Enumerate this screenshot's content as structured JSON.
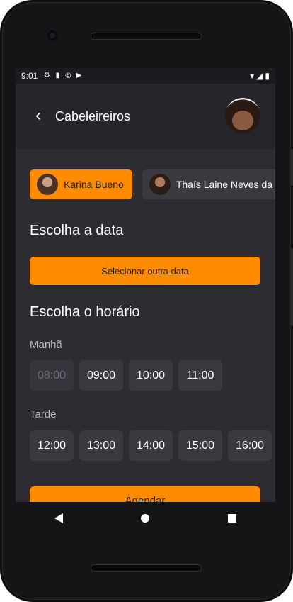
{
  "status_bar": {
    "time": "9:01",
    "icons": [
      "gear-icon",
      "sd-card-icon",
      "at-icon",
      "play-store-icon"
    ],
    "right_icons": [
      "wifi-icon",
      "signal-icon",
      "battery-icon"
    ]
  },
  "app_bar": {
    "title": "Cabeleireiros",
    "back_icon": "chevron-left-icon"
  },
  "professionals": [
    {
      "name": "Karina Bueno",
      "selected": true
    },
    {
      "name": "Thaís Laine Neves da S",
      "selected": false
    }
  ],
  "date_section": {
    "title": "Escolha a data",
    "button_label": "Selecionar outra data"
  },
  "time_section": {
    "title": "Escolha o horário",
    "morning_label": "Manhã",
    "morning_slots": [
      {
        "time": "08:00",
        "available": false
      },
      {
        "time": "09:00",
        "available": true
      },
      {
        "time": "10:00",
        "available": true
      },
      {
        "time": "11:00",
        "available": true
      }
    ],
    "afternoon_label": "Tarde",
    "afternoon_slots": [
      {
        "time": "12:00",
        "available": true
      },
      {
        "time": "13:00",
        "available": true
      },
      {
        "time": "14:00",
        "available": true
      },
      {
        "time": "15:00",
        "available": true
      },
      {
        "time": "16:00",
        "available": true
      }
    ]
  },
  "schedule_button": "Agendar",
  "colors": {
    "accent": "#ff8c00",
    "background": "#2d2c33",
    "appbar": "#26252b"
  }
}
